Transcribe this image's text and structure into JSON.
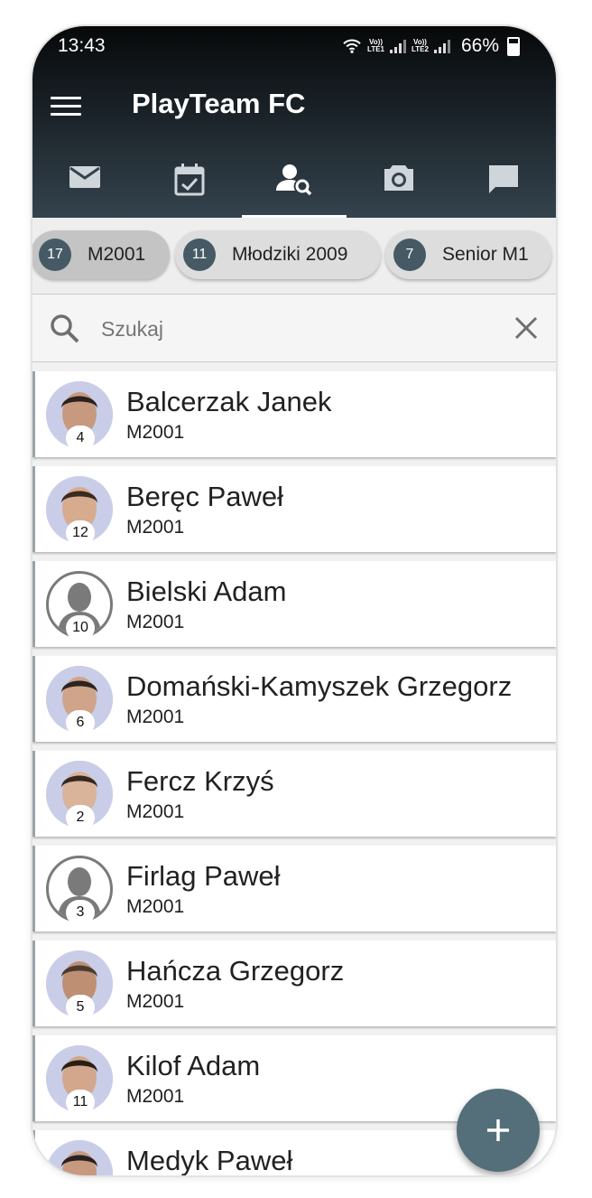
{
  "status_bar": {
    "time": "13:43",
    "sim1": "LTE1",
    "sim2": "LTE2",
    "volte": "Vo))",
    "battery": "66%"
  },
  "app": {
    "title": "PlayTeam FC",
    "menu_icon": "hamburger-menu-icon"
  },
  "tabs": [
    {
      "icon": "mail-icon",
      "active": false
    },
    {
      "icon": "calendar-check-icon",
      "active": false
    },
    {
      "icon": "person-search-icon",
      "active": true
    },
    {
      "icon": "camera-icon",
      "active": false
    },
    {
      "icon": "chat-icon",
      "active": false
    }
  ],
  "teams": [
    {
      "count": "17",
      "label": "M2001",
      "selected": true
    },
    {
      "count": "11",
      "label": "Młodziki 2009",
      "selected": false
    },
    {
      "count": "7",
      "label": "Senior M1",
      "selected": false
    }
  ],
  "search": {
    "placeholder": "Szukaj",
    "value": ""
  },
  "players": [
    {
      "name": "Balcerzak Janek",
      "team": "M2001",
      "number": "4",
      "photo": true
    },
    {
      "name": "Beręc Paweł",
      "team": "M2001",
      "number": "12",
      "photo": true
    },
    {
      "name": "Bielski Adam",
      "team": "M2001",
      "number": "10",
      "photo": false
    },
    {
      "name": "Domański-Kamyszek Grzegorz",
      "team": "M2001",
      "number": "6",
      "photo": true
    },
    {
      "name": "Fercz Krzyś",
      "team": "M2001",
      "number": "2",
      "photo": true
    },
    {
      "name": "Firlag Paweł",
      "team": "M2001",
      "number": "3",
      "photo": false
    },
    {
      "name": "Hańcza Grzegorz",
      "team": "M2001",
      "number": "5",
      "photo": true
    },
    {
      "name": "Kilof Adam",
      "team": "M2001",
      "number": "11",
      "photo": true
    },
    {
      "name": "Medyk Paweł",
      "team": "",
      "number": "",
      "photo": true
    }
  ],
  "fab": {
    "icon": "plus-icon"
  },
  "colors": {
    "header_top": "#07090a",
    "header_bottom": "#34434d",
    "chip_count_bg": "#455a64",
    "fab_bg": "#546e7a"
  }
}
